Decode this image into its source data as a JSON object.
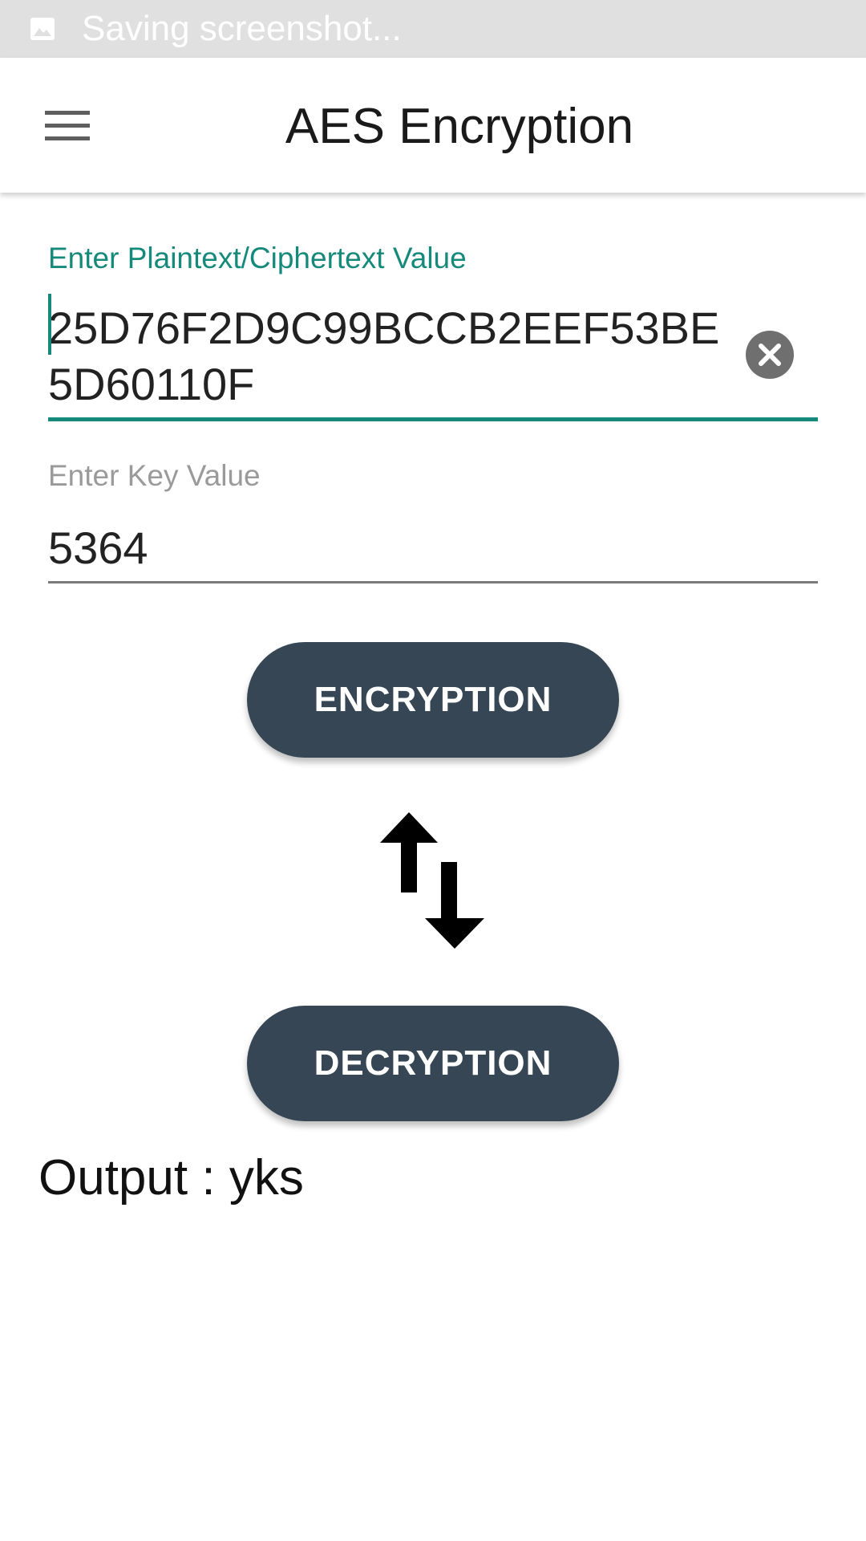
{
  "status_bar": {
    "text": "Saving screenshot...",
    "icon": "image-icon"
  },
  "app_bar": {
    "title": "AES Encryption",
    "menu_icon": "hamburger-menu-icon"
  },
  "form": {
    "plaintext_label": "Enter Plaintext/Ciphertext Value",
    "plaintext_value": "25D76F2D9C99BCCB2EEF53BE5D60110F",
    "plaintext_line1": "25D76F2D9C99BCCB2EEF53B",
    "plaintext_line2": "E5D60110F",
    "clear_icon": "clear-circle-icon",
    "key_label": "Enter Key Value",
    "key_value": "5364"
  },
  "actions": {
    "encrypt_label": "ENCRYPTION",
    "swap_icon": "swap-vertical-icon",
    "decrypt_label": "DECRYPTION"
  },
  "output": {
    "label": "Output",
    "separator": " : ",
    "value": "yks"
  },
  "colors": {
    "accent": "#15897a",
    "button": "#364654",
    "status_bar": "#e0e0e0"
  }
}
